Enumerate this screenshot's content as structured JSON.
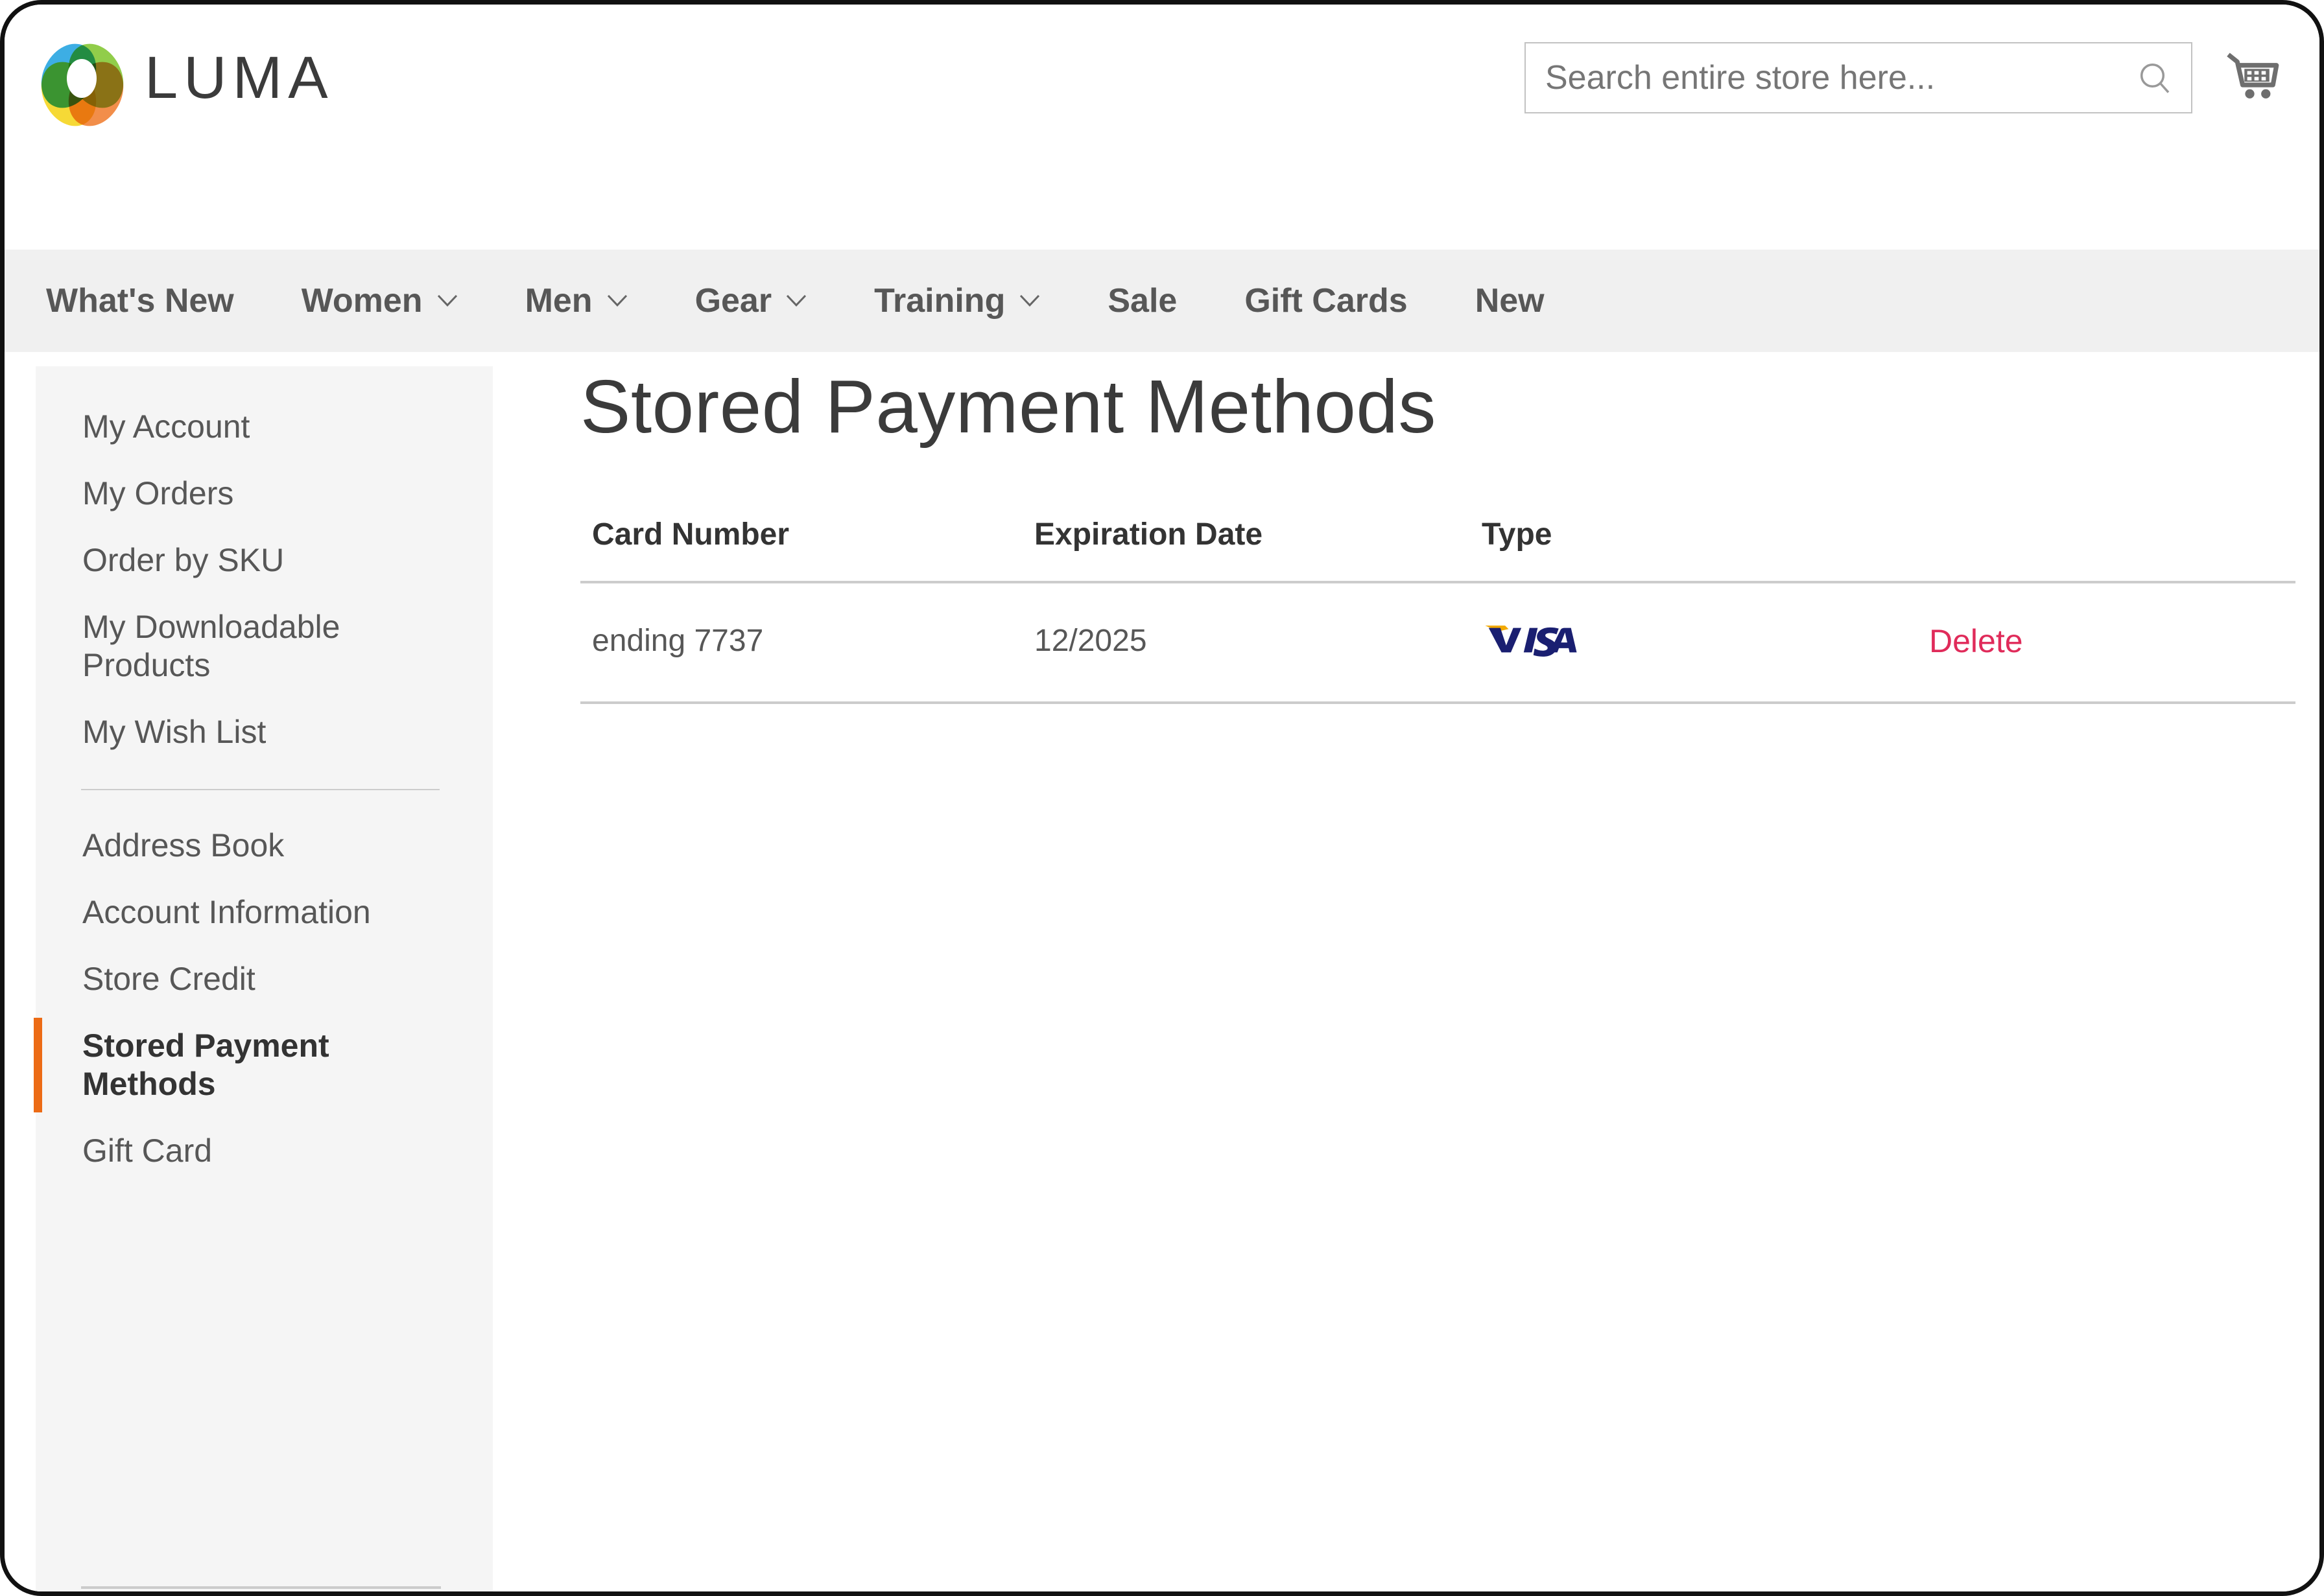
{
  "brand": {
    "name": "LUMA",
    "logo_icon": "luma-rings-logo"
  },
  "search": {
    "placeholder": "Search entire store here...",
    "value": "",
    "icon": "search-icon"
  },
  "cart": {
    "icon": "shopping-cart-icon"
  },
  "nav": {
    "items": [
      {
        "label": "What's New",
        "has_caret": false
      },
      {
        "label": "Women",
        "has_caret": true
      },
      {
        "label": "Men",
        "has_caret": true
      },
      {
        "label": "Gear",
        "has_caret": true
      },
      {
        "label": "Training",
        "has_caret": true
      },
      {
        "label": "Sale",
        "has_caret": false
      },
      {
        "label": "Gift Cards",
        "has_caret": false
      },
      {
        "label": "New",
        "has_caret": false
      }
    ]
  },
  "sidebar": {
    "group_one": [
      {
        "label": "My Account"
      },
      {
        "label": "My Orders"
      },
      {
        "label": "Order by SKU"
      },
      {
        "label": "My Downloadable Products"
      },
      {
        "label": "My Wish List"
      }
    ],
    "group_two": [
      {
        "label": "Address Book",
        "active": false
      },
      {
        "label": "Account Information",
        "active": false
      },
      {
        "label": "Store Credit",
        "active": false
      },
      {
        "label": "Stored Payment Methods",
        "active": true
      },
      {
        "label": "Gift Card",
        "active": false
      }
    ],
    "active_accent_color": "#ec6b15"
  },
  "main": {
    "page_title": "Stored Payment Methods",
    "table": {
      "columns": [
        "Card Number",
        "Expiration Date",
        "Type",
        ""
      ],
      "rows": [
        {
          "card_number": "ending 7737",
          "expiration_date": "12/2025",
          "type_icon": "visa-card-icon",
          "type_label": "VISA",
          "action_label": "Delete"
        }
      ]
    },
    "delete_link_color": "#e02b5a",
    "visa_blue": "#1a1f71",
    "visa_gold": "#f2a900"
  }
}
